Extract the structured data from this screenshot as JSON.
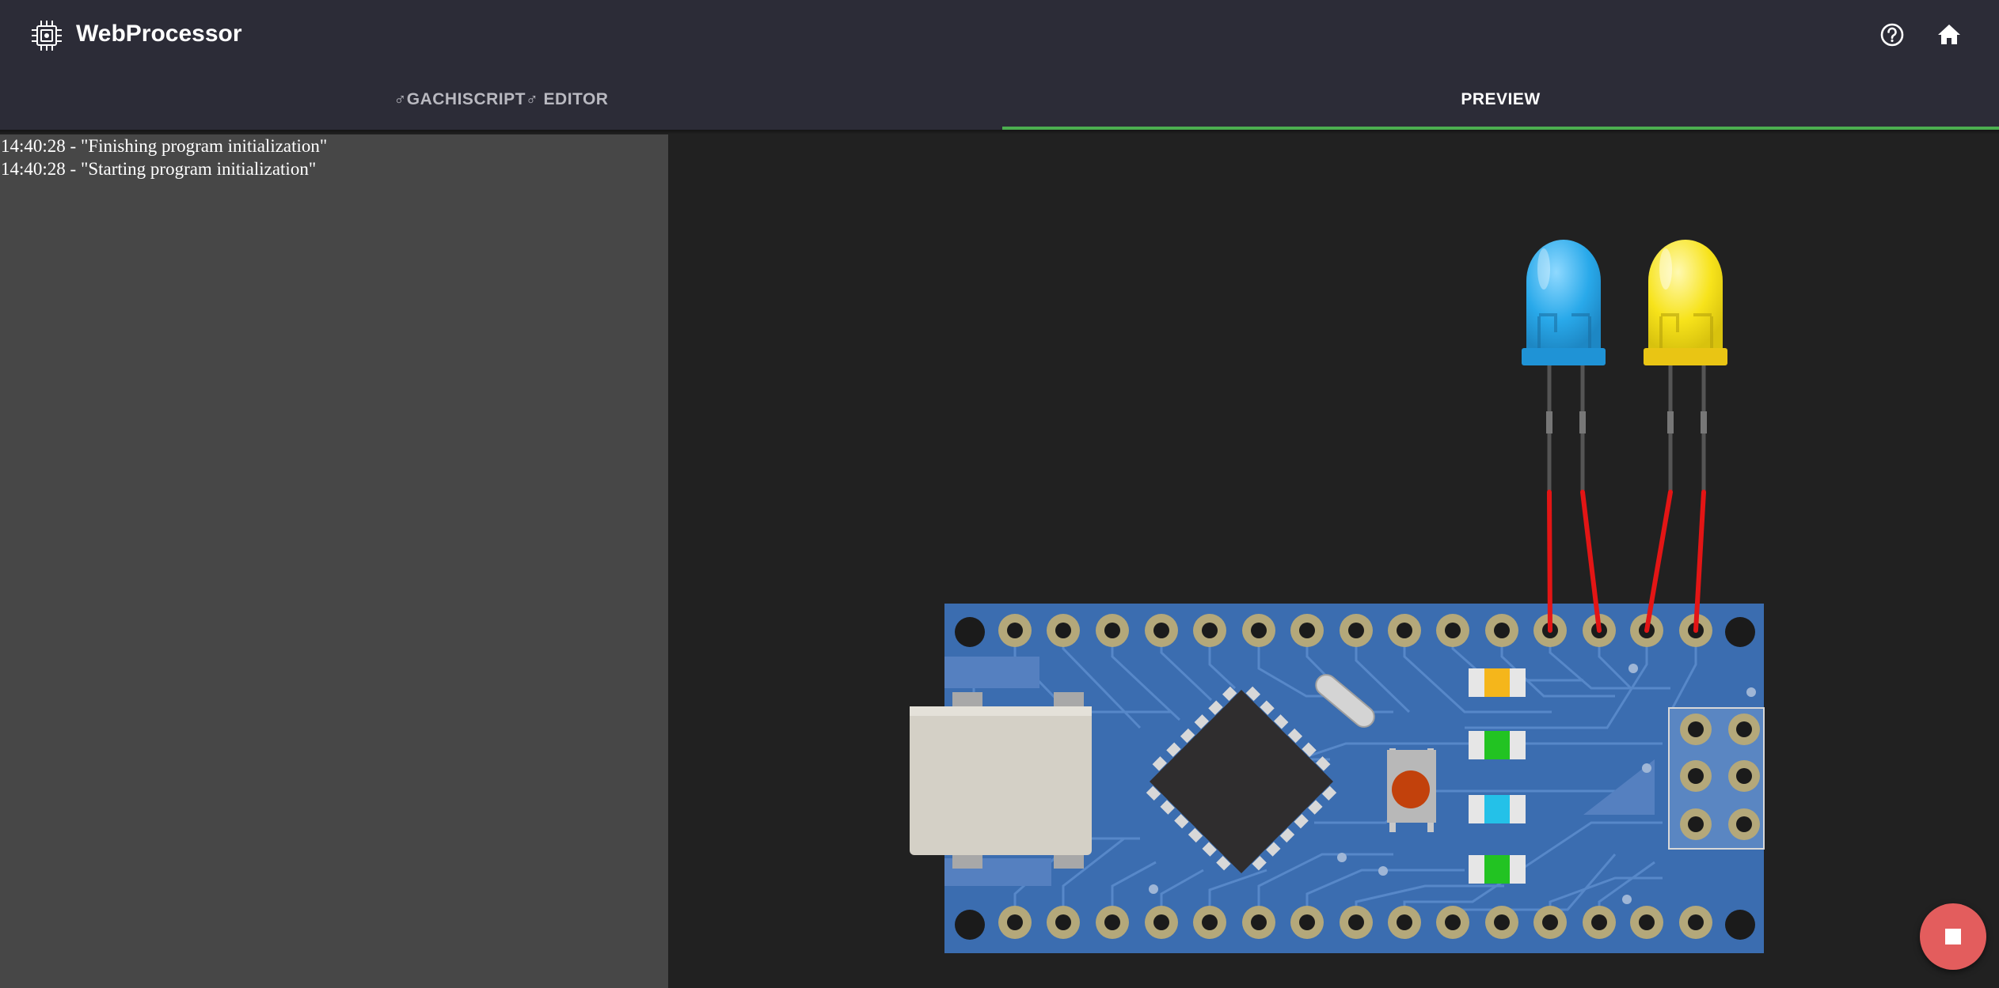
{
  "app": {
    "title": "WebProcessor",
    "logo_icon": "cpu-chip-icon"
  },
  "header_actions": [
    {
      "name": "help",
      "icon": "help-circle-icon"
    },
    {
      "name": "home",
      "icon": "home-icon"
    }
  ],
  "tabs": [
    {
      "label": "♂GACHISCRIPT♂ EDITOR",
      "active": false
    },
    {
      "label": "PREVIEW",
      "active": true
    }
  ],
  "console": {
    "lines": [
      "14:40:28 - \"Finishing program initialization\"",
      "14:40:28 - \"Starting program initialization\""
    ]
  },
  "preview": {
    "board": "arduino-nano",
    "leds": [
      {
        "color": "blue",
        "hex": "#29a9ea"
      },
      {
        "color": "yellow",
        "hex": "#f7e31b"
      }
    ],
    "wire_color": "#e31515",
    "pcb_color": "#3b6db0"
  },
  "fab": {
    "icon": "stop-icon"
  },
  "colors": {
    "accent": "#4caf50",
    "appbar": "#2c2c37",
    "fab": "#e35d5d"
  }
}
